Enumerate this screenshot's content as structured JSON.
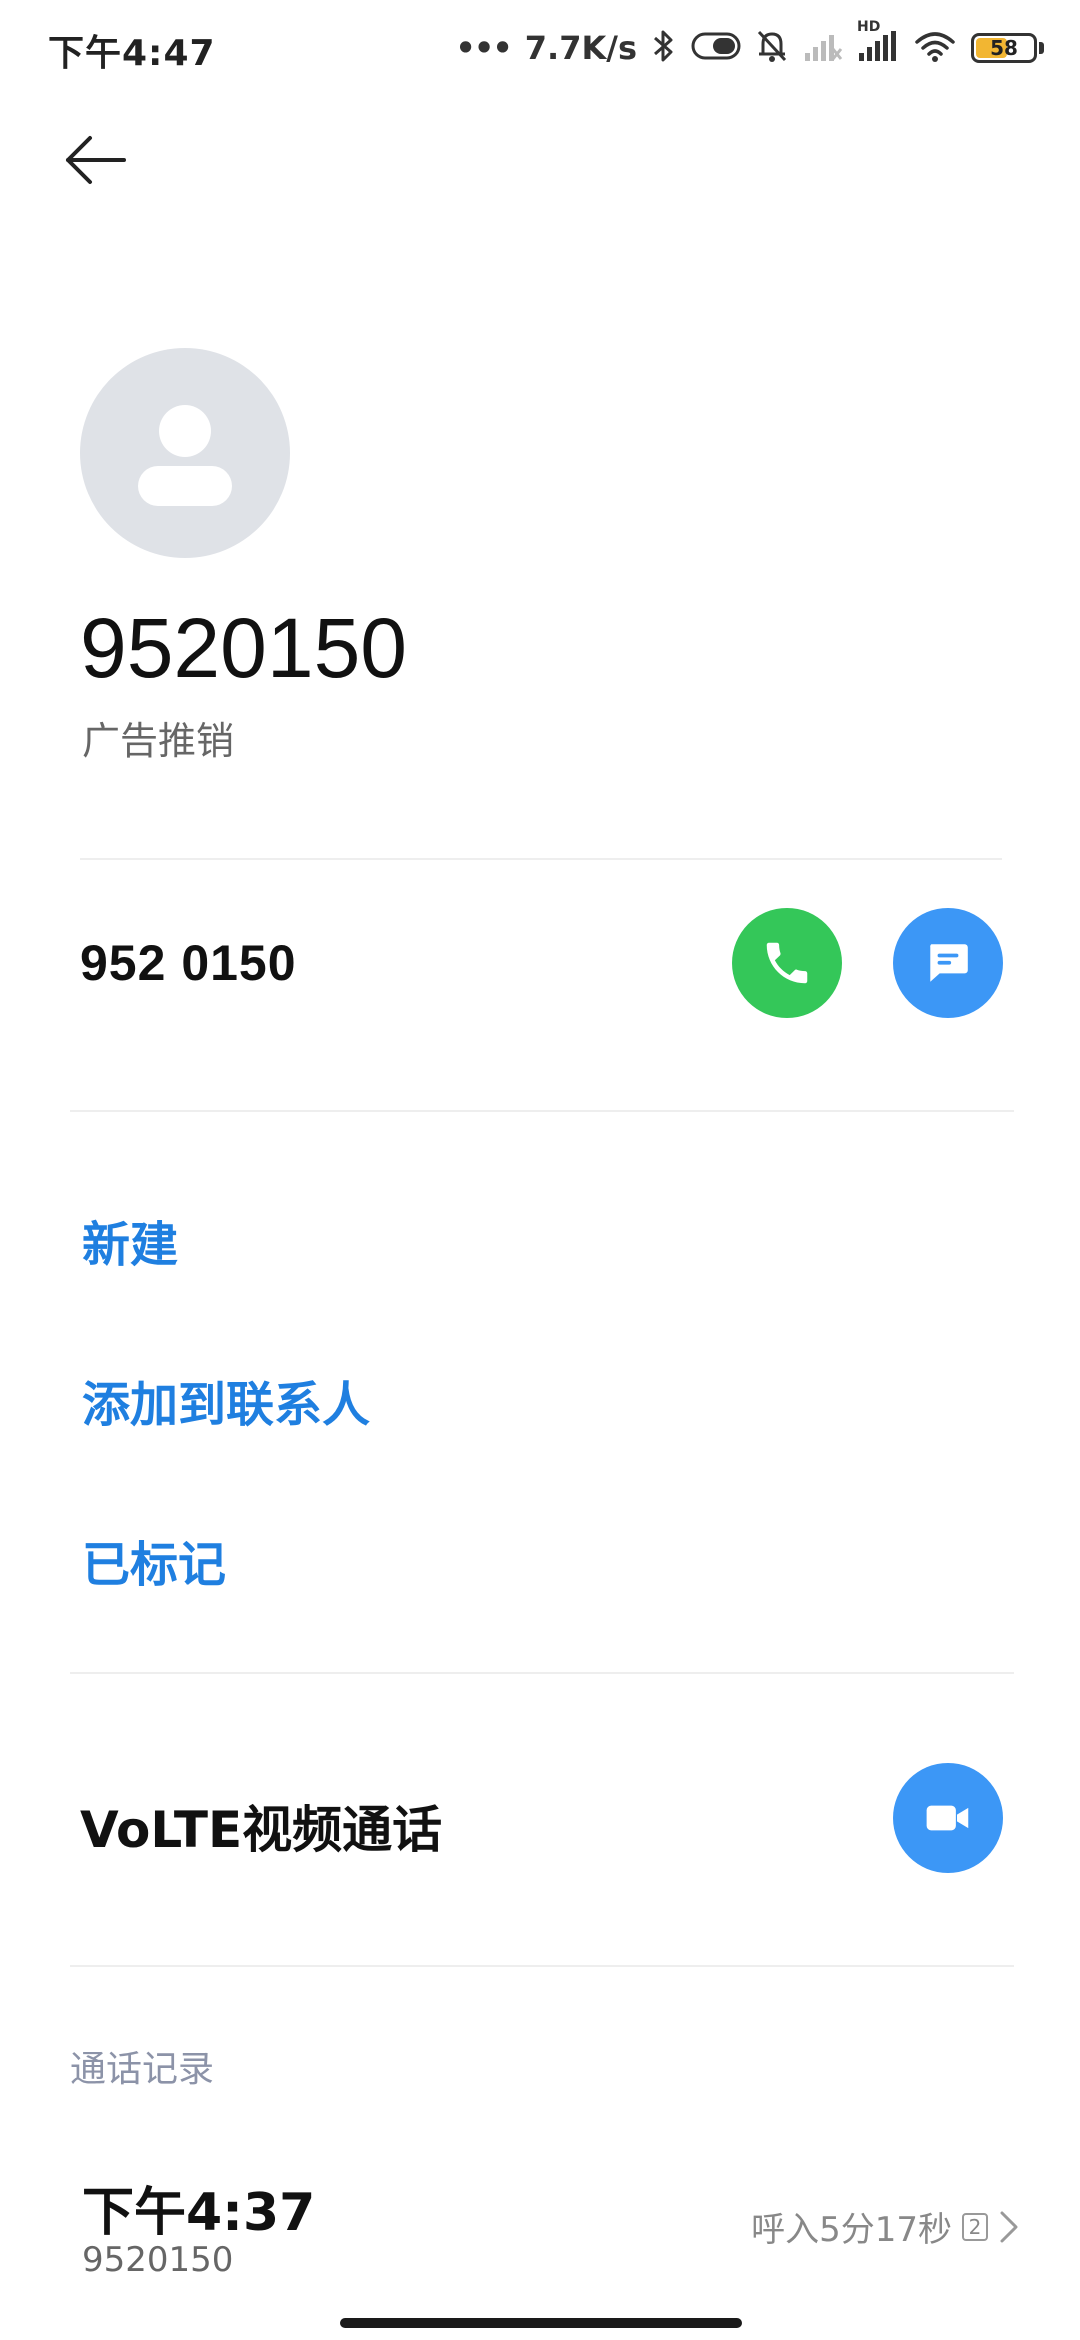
{
  "status_bar": {
    "time": "下午4:47",
    "dots": "•••",
    "network_speed": "7.7K/s",
    "hd_label": "HD",
    "battery_level": "58"
  },
  "header": {
    "back_icon": "arrow-left-icon"
  },
  "contact": {
    "avatar_icon": "person-icon",
    "display_number": "9520150",
    "tag": "广告推销"
  },
  "phone": {
    "number": "952 0150",
    "call_icon": "phone-icon",
    "message_icon": "message-icon"
  },
  "actions": [
    {
      "label": "新建"
    },
    {
      "label": "添加到联系人"
    },
    {
      "label": "已标记"
    }
  ],
  "volte": {
    "label": "VoLTE视频通话",
    "icon": "video-camera-icon"
  },
  "call_log": {
    "header": "通话记录",
    "entries": [
      {
        "time": "下午4:37",
        "number": "9520150",
        "detail": "呼入5分17秒",
        "count": "2"
      }
    ]
  },
  "colors": {
    "accent_blue": "#1f7fe0",
    "call_green": "#34c759",
    "button_blue": "#3c97f6",
    "avatar_gray": "#dfe2e7"
  }
}
